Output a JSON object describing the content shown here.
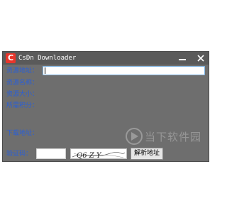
{
  "window": {
    "logo_letter": "C",
    "title": "CsDn Downloader",
    "minimize_icon": "minimize-icon",
    "close_icon": "close-icon"
  },
  "form": {
    "fields": [
      {
        "label": "资源地址：",
        "value": ""
      },
      {
        "label": "资源名称：",
        "value": ""
      },
      {
        "label": "资源大小：",
        "value": ""
      },
      {
        "label": "所需积分：",
        "value": ""
      }
    ],
    "download_label": "下载地址：",
    "captcha_label": "验证码：",
    "captcha_value": "",
    "captcha_text": "Q6 Z Y",
    "parse_button": "解析地址"
  },
  "watermark": {
    "text": "当下软件园"
  },
  "colors": {
    "window_bg": "#6e6e6e",
    "label_color": "#2a5fd6",
    "logo_red": "#e8352b"
  }
}
